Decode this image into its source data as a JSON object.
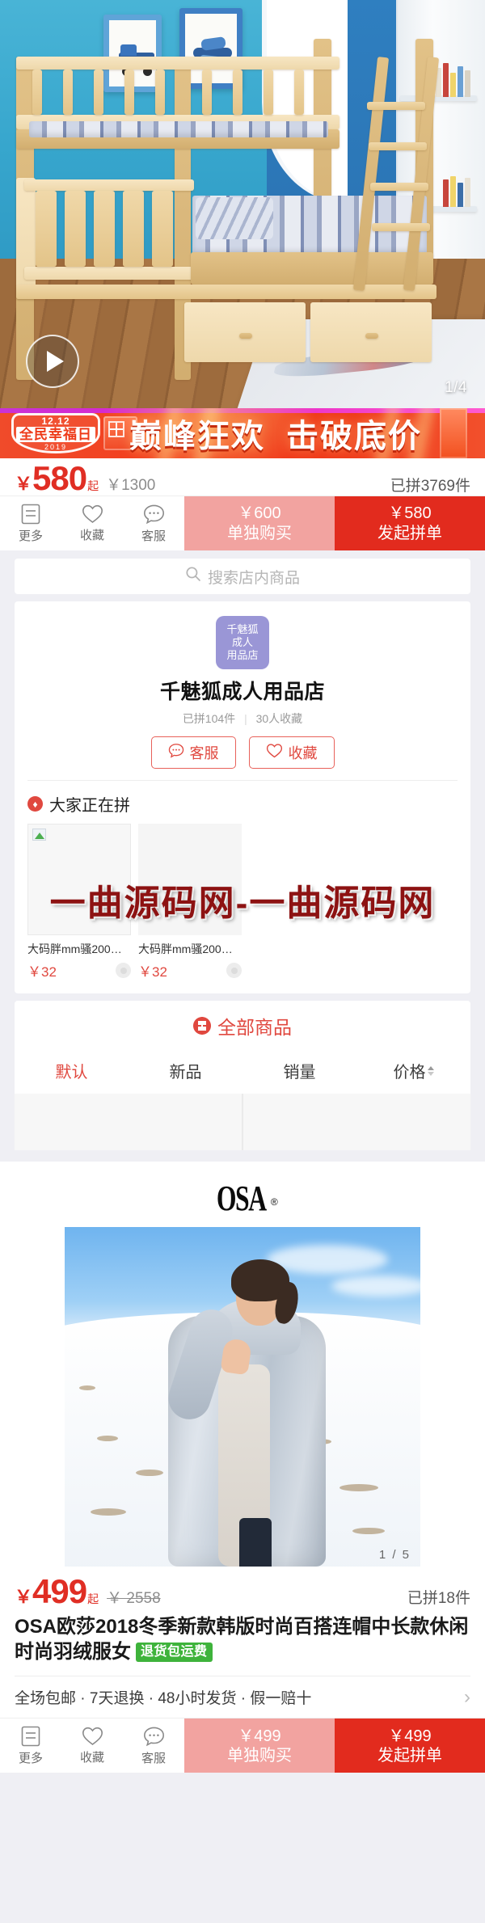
{
  "product1": {
    "gallery": {
      "page_indicator": "1/4",
      "play_icon": "play-icon"
    },
    "promo_banner": {
      "logo_line1": "12.12",
      "logo_line2": "全民幸福日",
      "logo_line3": "2019",
      "headline_1": "巅峰狂欢",
      "headline_2": "击破底价"
    },
    "price": {
      "currency": "￥",
      "amount": "580",
      "suffix": "起",
      "original": "￥1300",
      "sold": "已拼3769件"
    },
    "action_bar": {
      "icons": [
        {
          "label": "更多",
          "icon": "list-icon"
        },
        {
          "label": "收藏",
          "icon": "heart-icon"
        },
        {
          "label": "客服",
          "icon": "service-chat-icon"
        }
      ],
      "solo_price": "￥600",
      "solo_label": "单独购买",
      "group_price": "￥580",
      "group_label": "发起拼单"
    }
  },
  "store": {
    "search_placeholder": "搜索店内商品",
    "search_icon": "search-icon",
    "logo_text": "千魅狐\n成人\n用品店",
    "logo_lines": [
      "千魅狐",
      "成人",
      "用品店"
    ],
    "name": "千魅狐成人用品店",
    "stat_sold": "已拼104件",
    "stat_fav": "30人收藏",
    "buttons": [
      {
        "label": "客服",
        "icon": "service-chat-icon"
      },
      {
        "label": "收藏",
        "icon": "heart-icon"
      }
    ],
    "hot_section": {
      "icon": "flame-icon",
      "title": "大家正在拼",
      "items": [
        {
          "name": "大码胖mm骚200斤...",
          "price": "￥32"
        },
        {
          "name": "大码胖mm骚200斤...",
          "price": "￥32"
        }
      ]
    },
    "watermark": "一曲源码网-一曲源码网",
    "all_goods": {
      "icon": "grid-icon",
      "title": "全部商品",
      "sorts": [
        {
          "label": "默认",
          "active": true
        },
        {
          "label": "新品",
          "active": false
        },
        {
          "label": "销量",
          "active": false
        },
        {
          "label": "价格",
          "active": false,
          "has_arrows": true
        }
      ]
    }
  },
  "product2": {
    "brand_logo": "OSA",
    "brand_reg": "®",
    "gallery": {
      "page_indicator": "1 / 5"
    },
    "price": {
      "currency": "￥",
      "amount": "499",
      "suffix": "起",
      "original": "￥ 2558",
      "sold": "已拼18件"
    },
    "title": "OSA欧莎2018冬季新款韩版时尚百搭连帽中长款休闲时尚羽绒服女",
    "title_tag": "退货包运费",
    "promise": "全场包邮 · 7天退换 · 48小时发货 · 假一赔十",
    "promise_chevron": "›",
    "action_bar": {
      "icons": [
        {
          "label": "更多",
          "icon": "list-icon"
        },
        {
          "label": "收藏",
          "icon": "heart-icon"
        },
        {
          "label": "客服",
          "icon": "service-chat-icon"
        }
      ],
      "solo_price": "￥499",
      "solo_label": "单独购买",
      "group_price": "￥499",
      "group_label": "发起拼单"
    }
  },
  "colors": {
    "brand_red": "#e22b1e",
    "price_red": "#e02e24",
    "solo_pink": "#f2a3a0",
    "green_tag": "#3eb33b",
    "store_logo_purple": "#9a96d6",
    "watermark_red": "#8d1212"
  }
}
